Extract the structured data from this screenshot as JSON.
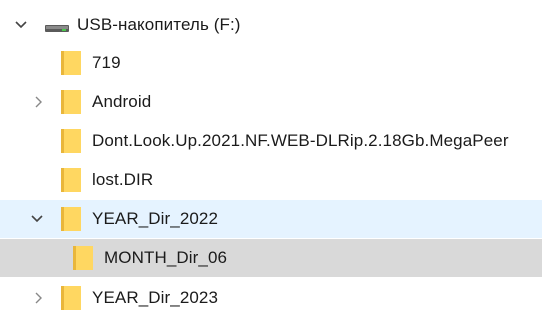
{
  "tree": {
    "root": {
      "label": "USB-накопитель (F:)",
      "expanded": true,
      "icon": "usb-drive-icon"
    },
    "items": [
      {
        "label": "719",
        "level": 1,
        "chevron": "none",
        "state": "normal"
      },
      {
        "label": "Android",
        "level": 1,
        "chevron": "collapsed",
        "state": "normal"
      },
      {
        "label": "Dont.Look.Up.2021.NF.WEB-DLRip.2.18Gb.MegaPeer",
        "level": 1,
        "chevron": "none",
        "state": "normal"
      },
      {
        "label": "lost.DIR",
        "level": 1,
        "chevron": "none",
        "state": "normal"
      },
      {
        "label": "YEAR_Dir_2022",
        "level": 1,
        "chevron": "expanded",
        "state": "hover"
      },
      {
        "label": "MONTH_Dir_06",
        "level": 2,
        "chevron": "none",
        "state": "selected"
      },
      {
        "label": "YEAR_Dir_2023",
        "level": 1,
        "chevron": "collapsed",
        "state": "normal"
      }
    ],
    "colors": {
      "folder_fill": "#ffd761",
      "folder_shade": "#e9b63b",
      "hover_bg": "#e5f3ff",
      "selected_bg": "#d9d9d9",
      "chevron": "#444444"
    }
  }
}
